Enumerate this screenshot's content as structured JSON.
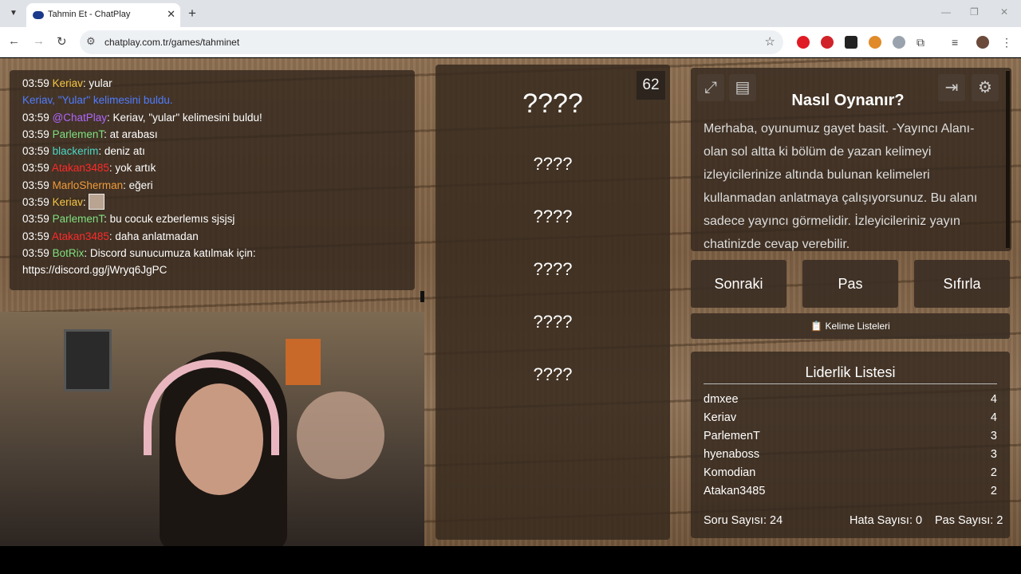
{
  "browser": {
    "tab_title": "Tahmin Et - ChatPlay",
    "url": "chatplay.com.tr/games/tahminet"
  },
  "chat": {
    "messages": [
      {
        "time": "03:59",
        "user": "Keriav",
        "user_color": "#f5c542",
        "text": ": yular"
      },
      {
        "time": "",
        "user": "Keriav, \"Yular\" kelimesini buldu.",
        "user_color": "#4f7cff",
        "text": ""
      },
      {
        "time": "03:59",
        "user": "@ChatPlay",
        "user_color": "#b066ff",
        "text": ": Keriav, \"yular\" kelimesini buldu!"
      },
      {
        "time": "03:59",
        "user": "ParlemenT",
        "user_color": "#7fe07f",
        "text": ": at arabası"
      },
      {
        "time": "03:59",
        "user": "blackerim",
        "user_color": "#4ad6c6",
        "text": ": deniz atı"
      },
      {
        "time": "03:59",
        "user": "Atakan3485",
        "user_color": "#ff2a2a",
        "text": ": yok artık"
      },
      {
        "time": "03:59",
        "user": "MarloSherman",
        "user_color": "#f09a3a",
        "text": ": eğeri"
      },
      {
        "time": "03:59",
        "user": "Keriav",
        "user_color": "#f5c542",
        "text": ": "
      },
      {
        "time": "03:59",
        "user": "ParlemenT",
        "user_color": "#7fe07f",
        "text": ": bu cocuk ezberlemıs sjsjsj"
      },
      {
        "time": "03:59",
        "user": "Atakan3485",
        "user_color": "#ff2a2a",
        "text": ": daha anlatmadan"
      },
      {
        "time": "03:59",
        "user": "BotRix",
        "user_color": "#7fe07f",
        "text": ": Discord sunucumuza katılmak için:"
      },
      {
        "time": "",
        "user": "",
        "user_color": "#ffffff",
        "text": "https://discord.gg/jWryq6JgPC"
      }
    ]
  },
  "game": {
    "timer": "62",
    "words": [
      "????",
      "????",
      "????",
      "????",
      "????",
      "????"
    ]
  },
  "help": {
    "title": "Nasıl Oynanır?",
    "text": "Merhaba, oyunumuz gayet basit. -Yayıncı Alanı- olan sol altta ki bölüm de yazan kelimeyi izleyicilerinize altında bulunan kelimeleri kullanmadan anlatmaya çalışıyorsunuz. Bu alanı sadece yayıncı görmelidir. İzleyicileriniz yayın chatinizde cevap verebilir."
  },
  "buttons": {
    "next": "Sonraki",
    "pass": "Pas",
    "reset": "Sıfırla",
    "word_lists": "📋 Kelime Listeleri"
  },
  "leaderboard": {
    "title": "Liderlik Listesi",
    "rows": [
      {
        "name": "dmxee",
        "score": "4"
      },
      {
        "name": "Keriav",
        "score": "4"
      },
      {
        "name": "ParlemenT",
        "score": "3"
      },
      {
        "name": "hyenaboss",
        "score": "3"
      },
      {
        "name": "Komodian",
        "score": "2"
      },
      {
        "name": "Atakan3485",
        "score": "2"
      }
    ],
    "question_count": "Soru Sayısı: 24",
    "error_count": "Hata Sayısı: 0",
    "pass_count": "Pas Sayısı: 2"
  }
}
